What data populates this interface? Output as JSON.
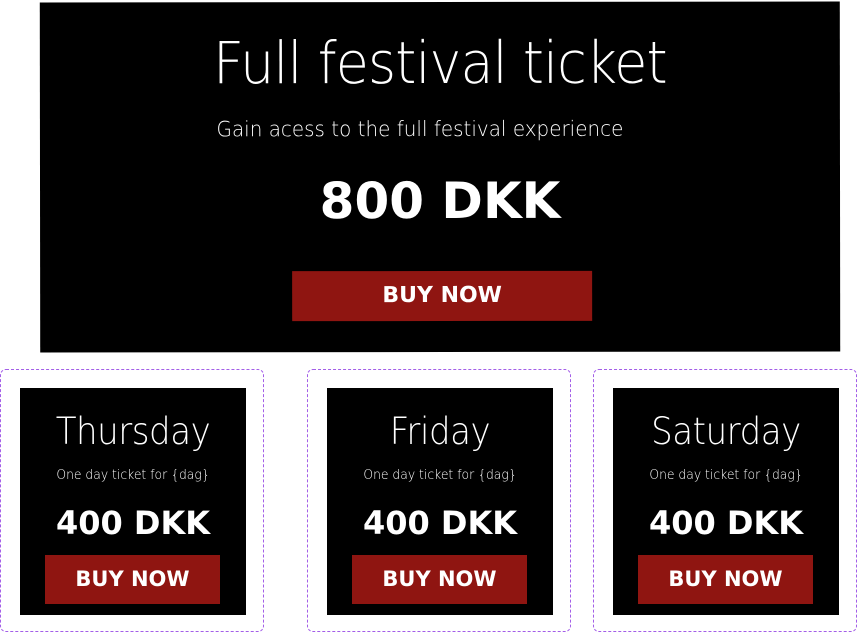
{
  "full_ticket": {
    "title": "Full festival ticket",
    "subtitle": "Gain acess to the full festival experience",
    "price": "800 DKK",
    "button_label": "BUY NOW"
  },
  "day_tickets": [
    {
      "day": "Thursday",
      "description": "One day ticket for {dag}",
      "price": "400 DKK",
      "button_label": "BUY NOW"
    },
    {
      "day": "Friday",
      "description": "One day ticket for {dag}",
      "price": "400 DKK",
      "button_label": "BUY NOW"
    },
    {
      "day": "Saturday",
      "description": "One day ticket for {dag}",
      "price": "400 DKK",
      "button_label": "BUY NOW"
    }
  ],
  "colors": {
    "card_background": "#000000",
    "button_background": "#8f1511",
    "text": "#ffffff",
    "dashed_outline": "#a35ee8"
  }
}
